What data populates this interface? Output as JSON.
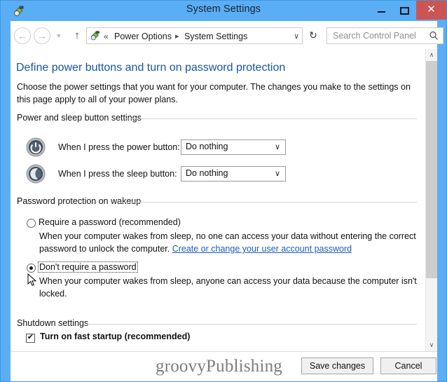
{
  "window": {
    "title": "System Settings",
    "icon": "power-options-icon",
    "controls": {
      "minimize": "minimize-icon",
      "maximize": "maximize-icon",
      "close": "✕"
    },
    "accent_color": "#5aaef5",
    "close_color": "#cc5452"
  },
  "navbar": {
    "back": "←",
    "forward": "→",
    "recent": "▼",
    "up": "↑",
    "refresh": "↻",
    "breadcrumb": {
      "overflow": "«",
      "items": [
        "Power Options",
        "System Settings"
      ],
      "separator": "▸",
      "dropdown": "∨"
    },
    "search": {
      "placeholder": "Search Control Panel",
      "value": "",
      "icon": "search-icon"
    }
  },
  "page": {
    "title": "Define power buttons and turn on password protection",
    "description": "Choose the power settings that you want for your computer. The changes you make to the settings on this page apply to all of your power plans.",
    "title_color": "#17559f"
  },
  "sections": {
    "power_sleep": {
      "header": "Power and sleep button settings",
      "rows": [
        {
          "icon": "power-button-icon",
          "label": "When I press the power button:",
          "value": "Do nothing",
          "arrow": "∨"
        },
        {
          "icon": "sleep-button-icon",
          "label": "When I press the sleep button:",
          "value": "Do nothing",
          "arrow": "∨"
        }
      ]
    },
    "password_protection": {
      "header": "Password protection on wakeup",
      "options": [
        {
          "label": "Require a password (recommended)",
          "selected": false,
          "focused": false,
          "help_before": "When your computer wakes from sleep, no one can access your data without entering the correct password to unlock the computer. ",
          "link": "Create or change your user account password",
          "help_after": ""
        },
        {
          "label": "Don't require a password",
          "selected": true,
          "focused": true,
          "help_before": "When your computer wakes from sleep, anyone can access your data because the computer isn't locked.",
          "link": "",
          "help_after": ""
        }
      ]
    },
    "shutdown": {
      "header": "Shutdown settings",
      "checkbox": {
        "label": "Turn on fast startup (recommended)",
        "checked": true
      }
    }
  },
  "bottom": {
    "watermark": "groovyPublishing",
    "save_label": "Save changes",
    "cancel_label": "Cancel"
  },
  "scrollbar": {
    "up": "∧",
    "down": "∨"
  }
}
